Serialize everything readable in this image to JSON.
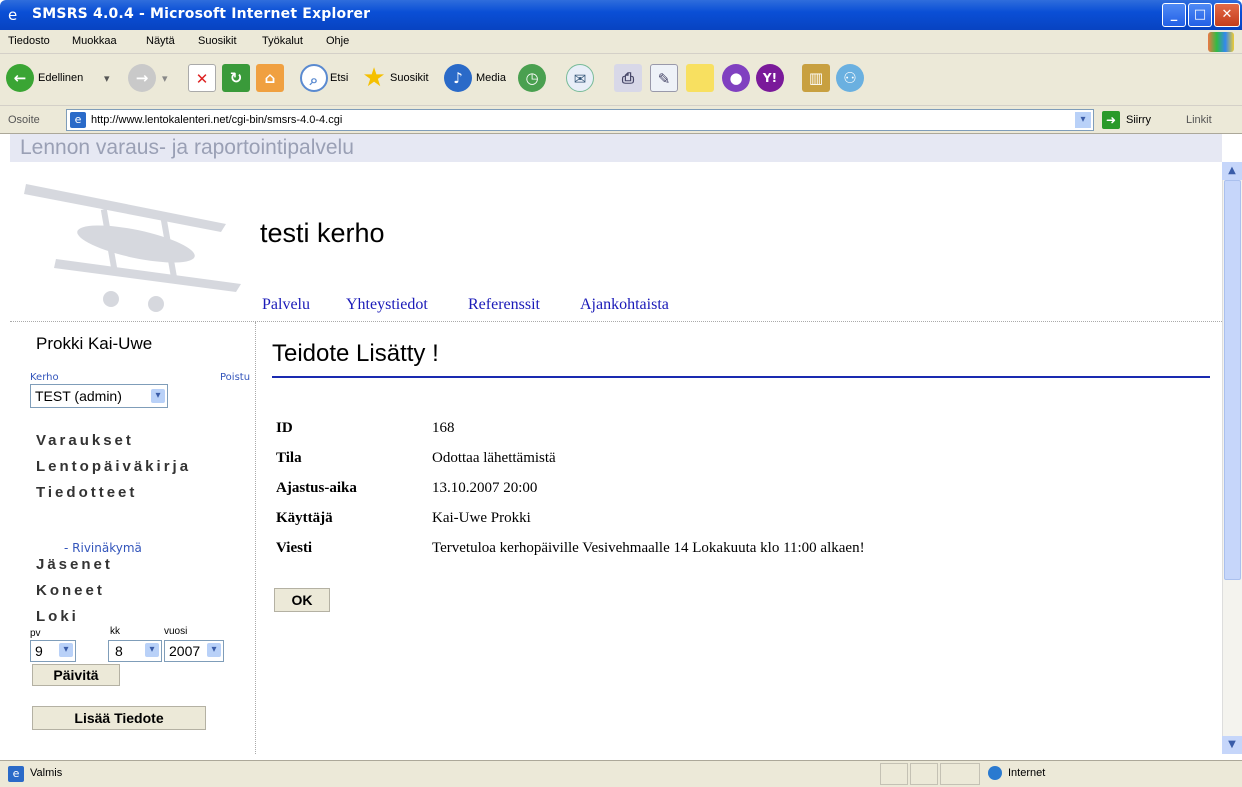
{
  "window": {
    "title": "SMSRS 4.0.4 - Microsoft Internet Explorer"
  },
  "menu": [
    "Tiedosto",
    "Muokkaa",
    "Näytä",
    "Suosikit",
    "Työkalut",
    "Ohje"
  ],
  "toolbar": {
    "back": "Edellinen",
    "search": "Etsi",
    "favorites": "Suosikit",
    "media": "Media"
  },
  "address": {
    "label": "Osoite",
    "url": "http://www.lentokalenteri.net/cgi-bin/smsrs-4.0-4.cgi",
    "go": "Siirry",
    "links": "Linkit"
  },
  "page": {
    "banner": "Lennon varaus- ja raportointipalvelu",
    "club": "testi kerho",
    "nav": [
      "Palvelu",
      "Yhteystiedot",
      "Referenssit",
      "Ajankohtaista"
    ]
  },
  "sidebar": {
    "user": "Prokki Kai-Uwe",
    "kerho_label": "Kerho",
    "logout": "Poistu",
    "club_select": "TEST (admin)",
    "items": [
      "Varaukset",
      "Lentopäiväkirja",
      "Tiedotteet",
      "Jäsenet",
      "Koneet",
      "Loki"
    ],
    "subitem": "- Rivinäkymä",
    "date_labels": {
      "day": "pv",
      "month": "kk",
      "year": "vuosi"
    },
    "date": {
      "day": "9",
      "month": "8",
      "year": "2007"
    },
    "refresh": "Päivitä",
    "add": "Lisää Tiedote"
  },
  "content": {
    "title": "Teidote Lisätty !",
    "rows": [
      {
        "k": "ID",
        "v": "168"
      },
      {
        "k": "Tila",
        "v": "Odottaa lähettämistä"
      },
      {
        "k": "Ajastus-aika",
        "v": "13.10.2007 20:00"
      },
      {
        "k": "Käyttäjä",
        "v": "Kai-Uwe Prokki"
      },
      {
        "k": "Viesti",
        "v": "Tervetuloa kerhopäiville Vesivehmaalle 14 Lokakuuta klo 11:00 alkaen!"
      }
    ],
    "ok": "OK"
  },
  "status": {
    "left": "Valmis",
    "zone": "Internet"
  }
}
